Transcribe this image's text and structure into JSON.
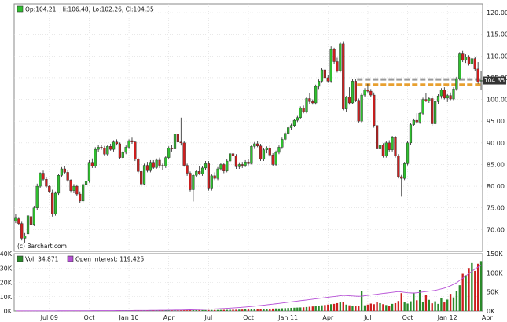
{
  "colors": {
    "background": "#ffffff",
    "grid": "#d9d9d9",
    "axis": "#888888",
    "up": "#2fbf2f",
    "down": "#cc1f1f",
    "wick": "#222222",
    "volume_up": "#2a8a2a",
    "volume_down": "#cc1f1f",
    "open_interest": "#b64fd6",
    "support_gray": "#9a9a9a",
    "support_orange": "#e8a030",
    "last_price_box": "#333333"
  },
  "chart_data": [
    {
      "type": "candlestick",
      "legend": {
        "text": "Op:104.21, Hi:106.48, Lo:102.26, Cl:104.35"
      },
      "watermark": "(c) Barchart.com",
      "last_price_label": "104.35",
      "ylim": [
        65,
        122
      ],
      "y_ticks": [
        70,
        75,
        80,
        85,
        90,
        95,
        100,
        105,
        110,
        115,
        120
      ],
      "y_tick_labels": [
        "70.00",
        "75.00",
        "80.00",
        "85.00",
        "90.00",
        "95.00",
        "100.00",
        "105.00",
        "110.00",
        "115.00",
        "120.00"
      ],
      "x_tick_labels": [
        "Jul 09",
        "Oct",
        "Jan 10",
        "Apr",
        "Jul",
        "Oct",
        "Jan 11",
        "Apr",
        "Jul",
        "Oct",
        "Jan 12",
        "Apr"
      ],
      "x_tick_index": [
        11,
        24,
        37,
        50,
        63,
        76,
        89,
        102,
        115,
        128,
        141,
        154
      ],
      "candles": [
        [
          72.0,
          73.5,
          71.5,
          72.8
        ],
        [
          72.5,
          72.9,
          71.0,
          71.4
        ],
        [
          71.4,
          71.8,
          67.5,
          68.0
        ],
        [
          68.0,
          69.2,
          67.0,
          68.5
        ],
        [
          69.0,
          73.5,
          68.8,
          73.2
        ],
        [
          73.0,
          73.8,
          70.8,
          71.2
        ],
        [
          71.2,
          75.5,
          70.8,
          75.0
        ],
        [
          75.0,
          80.6,
          74.5,
          80.0
        ],
        [
          80.0,
          83.2,
          79.6,
          83.0
        ],
        [
          83.0,
          83.6,
          81.2,
          81.6
        ],
        [
          81.6,
          82.1,
          79.5,
          80.0
        ],
        [
          80.0,
          80.2,
          78.4,
          78.8
        ],
        [
          78.4,
          79.2,
          73.0,
          73.6
        ],
        [
          73.6,
          78.8,
          73.2,
          78.4
        ],
        [
          78.4,
          82.8,
          78.0,
          82.5
        ],
        [
          82.5,
          84.4,
          82.0,
          84.0
        ],
        [
          84.0,
          84.6,
          82.8,
          83.2
        ],
        [
          83.2,
          83.8,
          81.0,
          81.4
        ],
        [
          81.4,
          81.6,
          78.5,
          79.0
        ],
        [
          79.0,
          80.5,
          78.4,
          80.0
        ],
        [
          80.0,
          80.4,
          77.8,
          78.2
        ],
        [
          78.2,
          78.8,
          76.2,
          76.6
        ],
        [
          76.6,
          80.8,
          76.2,
          80.4
        ],
        [
          80.4,
          81.6,
          79.8,
          81.2
        ],
        [
          81.2,
          86.0,
          80.8,
          85.5
        ],
        [
          85.5,
          86.4,
          84.2,
          84.6
        ],
        [
          84.6,
          89.0,
          84.2,
          88.5
        ],
        [
          88.5,
          89.5,
          87.8,
          89.0
        ],
        [
          89.0,
          89.6,
          88.4,
          88.8
        ],
        [
          88.8,
          89.3,
          87.0,
          87.4
        ],
        [
          87.4,
          89.6,
          87.0,
          89.2
        ],
        [
          89.2,
          89.8,
          88.2,
          88.5
        ],
        [
          88.5,
          90.6,
          88.0,
          90.2
        ],
        [
          90.2,
          90.8,
          89.4,
          89.8
        ],
        [
          89.8,
          90.1,
          86.2,
          86.6
        ],
        [
          86.6,
          88.2,
          86.4,
          87.8
        ],
        [
          87.8,
          89.4,
          87.4,
          89.0
        ],
        [
          89.0,
          90.8,
          88.6,
          90.5
        ],
        [
          90.5,
          91.2,
          89.8,
          90.2
        ],
        [
          90.2,
          90.4,
          85.8,
          86.2
        ],
        [
          86.2,
          86.6,
          83.0,
          83.4
        ],
        [
          83.4,
          83.8,
          80.0,
          80.5
        ],
        [
          80.5,
          85.2,
          80.2,
          84.8
        ],
        [
          84.8,
          85.6,
          83.2,
          83.6
        ],
        [
          83.6,
          86.0,
          83.2,
          85.5
        ],
        [
          85.5,
          86.0,
          84.0,
          84.3
        ],
        [
          84.3,
          86.4,
          84.0,
          86.0
        ],
        [
          86.0,
          86.6,
          84.2,
          84.8
        ],
        [
          84.8,
          85.2,
          83.8,
          84.6
        ],
        [
          84.6,
          87.0,
          84.2,
          86.6
        ],
        [
          86.6,
          89.2,
          86.2,
          88.8
        ],
        [
          88.8,
          89.6,
          88.0,
          88.6
        ],
        [
          88.6,
          92.3,
          88.2,
          92.0
        ],
        [
          92.0,
          92.4,
          89.8,
          90.2
        ],
        [
          90.2,
          95.8,
          89.4,
          90.0
        ],
        [
          90.0,
          90.4,
          84.5,
          84.8
        ],
        [
          84.8,
          85.2,
          82.4,
          83.0
        ],
        [
          83.0,
          83.4,
          78.8,
          79.2
        ],
        [
          79.2,
          82.8,
          76.5,
          82.5
        ],
        [
          82.5,
          83.8,
          82.0,
          83.4
        ],
        [
          83.4,
          84.6,
          82.6,
          82.8
        ],
        [
          82.8,
          84.6,
          82.4,
          84.2
        ],
        [
          84.2,
          85.8,
          83.8,
          85.2
        ],
        [
          85.2,
          85.8,
          79.0,
          79.4
        ],
        [
          79.4,
          82.8,
          79.0,
          82.4
        ],
        [
          82.4,
          83.2,
          81.4,
          81.8
        ],
        [
          81.8,
          84.4,
          81.4,
          84.0
        ],
        [
          84.0,
          85.4,
          83.6,
          85.0
        ],
        [
          85.0,
          85.4,
          83.0,
          83.5
        ],
        [
          83.5,
          86.2,
          83.2,
          85.8
        ],
        [
          85.8,
          87.8,
          85.4,
          87.5
        ],
        [
          87.5,
          88.6,
          86.8,
          87.0
        ],
        [
          87.0,
          87.4,
          84.0,
          84.5
        ],
        [
          84.5,
          85.5,
          84.0,
          85.0
        ],
        [
          85.0,
          85.6,
          84.2,
          84.8
        ],
        [
          84.8,
          86.0,
          84.4,
          85.6
        ],
        [
          85.6,
          86.2,
          84.8,
          85.2
        ],
        [
          85.2,
          89.6,
          85.0,
          89.2
        ],
        [
          89.2,
          90.2,
          88.6,
          89.8
        ],
        [
          89.8,
          90.4,
          89.0,
          89.3
        ],
        [
          89.3,
          89.8,
          85.8,
          86.2
        ],
        [
          86.2,
          88.8,
          85.8,
          88.4
        ],
        [
          88.4,
          89.2,
          87.6,
          88.8
        ],
        [
          88.8,
          89.5,
          86.8,
          87.2
        ],
        [
          87.2,
          87.6,
          84.6,
          85.0
        ],
        [
          85.0,
          88.2,
          84.6,
          87.8
        ],
        [
          87.8,
          89.4,
          87.4,
          89.0
        ],
        [
          89.0,
          91.2,
          88.6,
          90.8
        ],
        [
          90.8,
          92.6,
          90.4,
          92.2
        ],
        [
          92.2,
          93.8,
          91.8,
          93.5
        ],
        [
          93.5,
          94.4,
          93.0,
          94.0
        ],
        [
          94.0,
          95.4,
          93.6,
          95.2
        ],
        [
          95.2,
          96.2,
          94.8,
          95.8
        ],
        [
          95.8,
          98.4,
          95.4,
          98.0
        ],
        [
          98.0,
          98.6,
          96.8,
          97.2
        ],
        [
          97.2,
          100.6,
          96.8,
          100.2
        ],
        [
          100.2,
          101.4,
          99.0,
          99.5
        ],
        [
          99.5,
          100.0,
          98.8,
          99.2
        ],
        [
          99.2,
          103.4,
          98.8,
          103.0
        ],
        [
          103.0,
          104.6,
          102.4,
          104.2
        ],
        [
          104.2,
          107.2,
          103.8,
          106.8
        ],
        [
          106.8,
          107.8,
          104.5,
          105.0
        ],
        [
          105.0,
          105.6,
          103.8,
          104.2
        ],
        [
          104.2,
          112.2,
          103.8,
          111.5
        ],
        [
          111.5,
          111.9,
          108.2,
          108.7
        ],
        [
          108.7,
          109.6,
          106.2,
          106.6
        ],
        [
          106.6,
          113.2,
          106.2,
          112.8
        ],
        [
          112.8,
          113.4,
          97.5,
          97.8
        ],
        [
          97.8,
          100.8,
          97.2,
          100.5
        ],
        [
          100.5,
          102.8,
          98.8,
          99.2
        ],
        [
          99.2,
          104.8,
          99.0,
          104.2
        ],
        [
          104.2,
          104.8,
          99.4,
          99.8
        ],
        [
          99.8,
          100.2,
          94.5,
          95.0
        ],
        [
          95.0,
          101.4,
          94.6,
          101.0
        ],
        [
          101.0,
          102.6,
          100.6,
          102.2
        ],
        [
          102.2,
          103.6,
          101.6,
          101.9
        ],
        [
          101.9,
          102.4,
          100.6,
          101.0
        ],
        [
          101.0,
          101.6,
          93.5,
          94.0
        ],
        [
          94.0,
          94.4,
          88.2,
          88.6
        ],
        [
          88.6,
          89.8,
          82.8,
          89.5
        ],
        [
          89.5,
          89.9,
          86.6,
          87.0
        ],
        [
          87.0,
          90.4,
          86.6,
          90.0
        ],
        [
          90.0,
          90.6,
          88.0,
          88.4
        ],
        [
          88.4,
          91.6,
          88.0,
          91.2
        ],
        [
          91.2,
          91.6,
          86.6,
          87.0
        ],
        [
          87.0,
          87.4,
          81.8,
          82.2
        ],
        [
          82.2,
          82.6,
          77.6,
          81.8
        ],
        [
          81.8,
          85.6,
          81.4,
          85.2
        ],
        [
          85.2,
          90.4,
          84.8,
          90.0
        ],
        [
          90.0,
          94.6,
          89.6,
          94.2
        ],
        [
          94.2,
          95.6,
          93.8,
          95.2
        ],
        [
          95.2,
          96.8,
          94.4,
          94.8
        ],
        [
          94.8,
          97.2,
          94.4,
          96.8
        ],
        [
          96.8,
          100.4,
          96.4,
          100.0
        ],
        [
          100.0,
          101.5,
          99.4,
          99.6
        ],
        [
          99.6,
          100.5,
          99.2,
          100.2
        ],
        [
          100.2,
          100.8,
          93.8,
          94.4
        ],
        [
          94.4,
          99.8,
          94.0,
          99.5
        ],
        [
          99.5,
          101.2,
          99.0,
          100.8
        ],
        [
          100.8,
          102.6,
          100.2,
          102.2
        ],
        [
          102.2,
          102.8,
          100.0,
          100.3
        ],
        [
          100.3,
          101.2,
          99.4,
          100.9
        ],
        [
          100.9,
          101.6,
          99.8,
          100.1
        ],
        [
          100.1,
          102.8,
          99.8,
          102.4
        ],
        [
          102.4,
          105.2,
          102.0,
          104.8
        ],
        [
          104.8,
          110.9,
          104.4,
          110.5
        ],
        [
          110.5,
          111.2,
          108.6,
          109.0
        ],
        [
          109.0,
          110.4,
          108.4,
          109.8
        ],
        [
          109.8,
          110.2,
          107.8,
          108.2
        ],
        [
          108.2,
          109.8,
          107.6,
          109.4
        ],
        [
          109.4,
          109.8,
          106.6,
          107.0
        ],
        [
          107.0,
          108.6,
          103.6,
          104.0
        ],
        [
          104.21,
          106.48,
          102.26,
          104.35
        ]
      ],
      "support_lines": [
        {
          "name": "gray",
          "value": 104.6
        },
        {
          "name": "orange",
          "value": 103.4
        }
      ]
    },
    {
      "type": "bar",
      "legend": [
        {
          "text": "Vol: 34,871"
        },
        {
          "text": "Open Interest: 119,425"
        }
      ],
      "left_axis": {
        "ylim": [
          0,
          40000
        ],
        "ticks": [
          0,
          10000,
          20000,
          30000,
          40000
        ],
        "tick_labels": [
          "0K",
          "10K",
          "20K",
          "30K",
          "40K"
        ]
      },
      "right_axis": {
        "ylim": [
          0,
          150000
        ],
        "ticks": [
          0,
          50000,
          100000,
          150000
        ],
        "tick_labels": [
          "0K",
          "50K",
          "100K",
          "150K"
        ]
      },
      "volume": [
        200,
        150,
        180,
        210,
        160,
        190,
        220,
        170,
        250,
        200,
        180,
        210,
        230,
        190,
        200,
        170,
        220,
        240,
        260,
        210,
        230,
        200,
        250,
        270,
        220,
        240,
        260,
        230,
        280,
        250,
        300,
        260,
        240,
        270,
        290,
        310,
        280,
        260,
        300,
        320,
        350,
        330,
        300,
        340,
        360,
        380,
        350,
        400,
        370,
        390,
        420,
        450,
        430,
        460,
        480,
        500,
        470,
        520,
        540,
        560,
        600,
        580,
        620,
        650,
        700,
        680,
        720,
        760,
        800,
        780,
        850,
        900,
        880,
        950,
        1000,
        1100,
        1050,
        1200,
        1300,
        1250,
        1400,
        1500,
        1450,
        1600,
        1700,
        1800,
        1750,
        1900,
        2000,
        2100,
        2200,
        2300,
        2400,
        2500,
        2600,
        2800,
        3000,
        3200,
        3500,
        3800,
        4000,
        4200,
        4500,
        4800,
        5000,
        5500,
        6000,
        6500,
        4500,
        4000,
        3800,
        3600,
        3500,
        14200,
        4000,
        4500,
        5200,
        4800,
        6000,
        5500,
        4800,
        4200,
        3800,
        5000,
        5500,
        7000,
        12500,
        6000,
        5200,
        6800,
        12800,
        7500,
        14800,
        6500,
        11200,
        7800,
        5400,
        6800,
        5000,
        9000,
        6000,
        8000,
        12000,
        9500,
        14000,
        18000,
        26000,
        25000,
        30000,
        33500,
        28000,
        33000,
        34871
      ],
      "open_interest": [
        300,
        310,
        320,
        330,
        340,
        350,
        360,
        380,
        400,
        420,
        430,
        450,
        470,
        480,
        500,
        520,
        540,
        560,
        580,
        600,
        620,
        650,
        680,
        700,
        720,
        750,
        780,
        800,
        830,
        860,
        900,
        940,
        980,
        1020,
        1060,
        1100,
        1150,
        1200,
        1250,
        1300,
        1350,
        1400,
        1450,
        1500,
        1550,
        1600,
        1700,
        1800,
        1900,
        2000,
        2100,
        2200,
        2300,
        2400,
        2500,
        2700,
        2900,
        3100,
        3300,
        3500,
        3800,
        4100,
        4400,
        4700,
        5000,
        5400,
        5800,
        6200,
        6600,
        7000,
        7500,
        8000,
        8600,
        9200,
        9800,
        10500,
        11200,
        12000,
        12800,
        13600,
        14500,
        15400,
        16300,
        17200,
        18000,
        19000,
        20000,
        21000,
        22000,
        23000,
        24000,
        25000,
        26000,
        27000,
        28000,
        29000,
        30000,
        31000,
        32000,
        33000,
        34000,
        35000,
        36000,
        37000,
        38000,
        39000,
        40000,
        41000,
        40500,
        40000,
        39500,
        39000,
        38500,
        39000,
        40000,
        41000,
        42000,
        43000,
        44000,
        45000,
        46000,
        47000,
        48000,
        49000,
        50000,
        51000,
        50000,
        49000,
        48000,
        47500,
        47000,
        48000,
        49000,
        50000,
        51000,
        52000,
        53000,
        54000,
        56000,
        58000,
        60000,
        63000,
        66000,
        70000,
        74000,
        80000,
        86000,
        92000,
        98000,
        104000,
        110000,
        115000,
        119425
      ]
    }
  ]
}
